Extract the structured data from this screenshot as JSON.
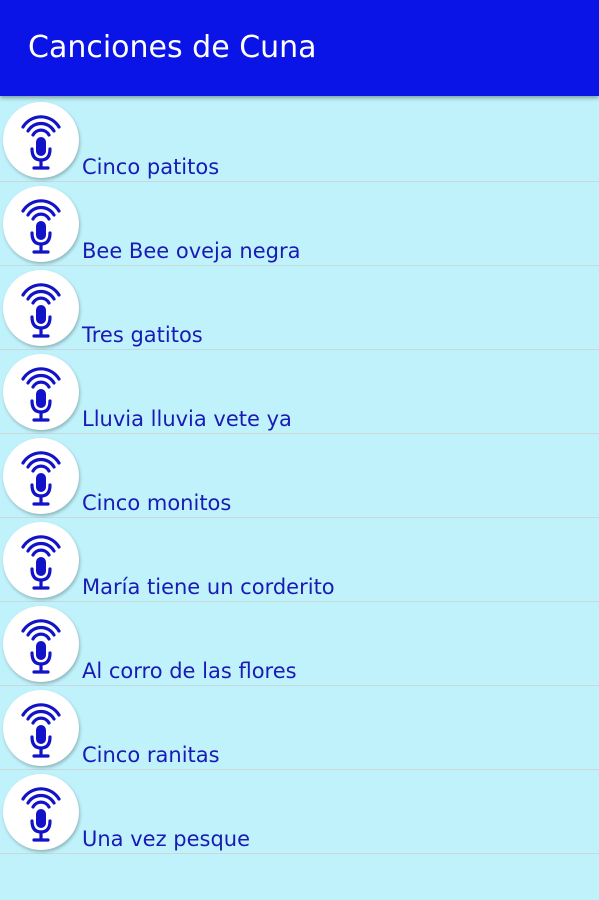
{
  "app_bar": {
    "title": "Canciones de Cuna",
    "background": "#0a14e6"
  },
  "theme": {
    "list_background": "#bff2fb",
    "item_text_color": "#1a1ab4",
    "icon_color": "#1212c8"
  },
  "songs": [
    {
      "title": "Cinco patitos",
      "icon": "microphone-icon"
    },
    {
      "title": "Bee Bee oveja negra",
      "icon": "microphone-icon"
    },
    {
      "title": "Tres gatitos",
      "icon": "microphone-icon"
    },
    {
      "title": "Lluvia lluvia vete ya",
      "icon": "microphone-icon"
    },
    {
      "title": "Cinco monitos",
      "icon": "microphone-icon"
    },
    {
      "title": "María tiene un corderito",
      "icon": "microphone-icon"
    },
    {
      "title": "Al corro de las flores",
      "icon": "microphone-icon"
    },
    {
      "title": "Cinco ranitas",
      "icon": "microphone-icon"
    },
    {
      "title": "Una vez pesque",
      "icon": "microphone-icon"
    }
  ]
}
